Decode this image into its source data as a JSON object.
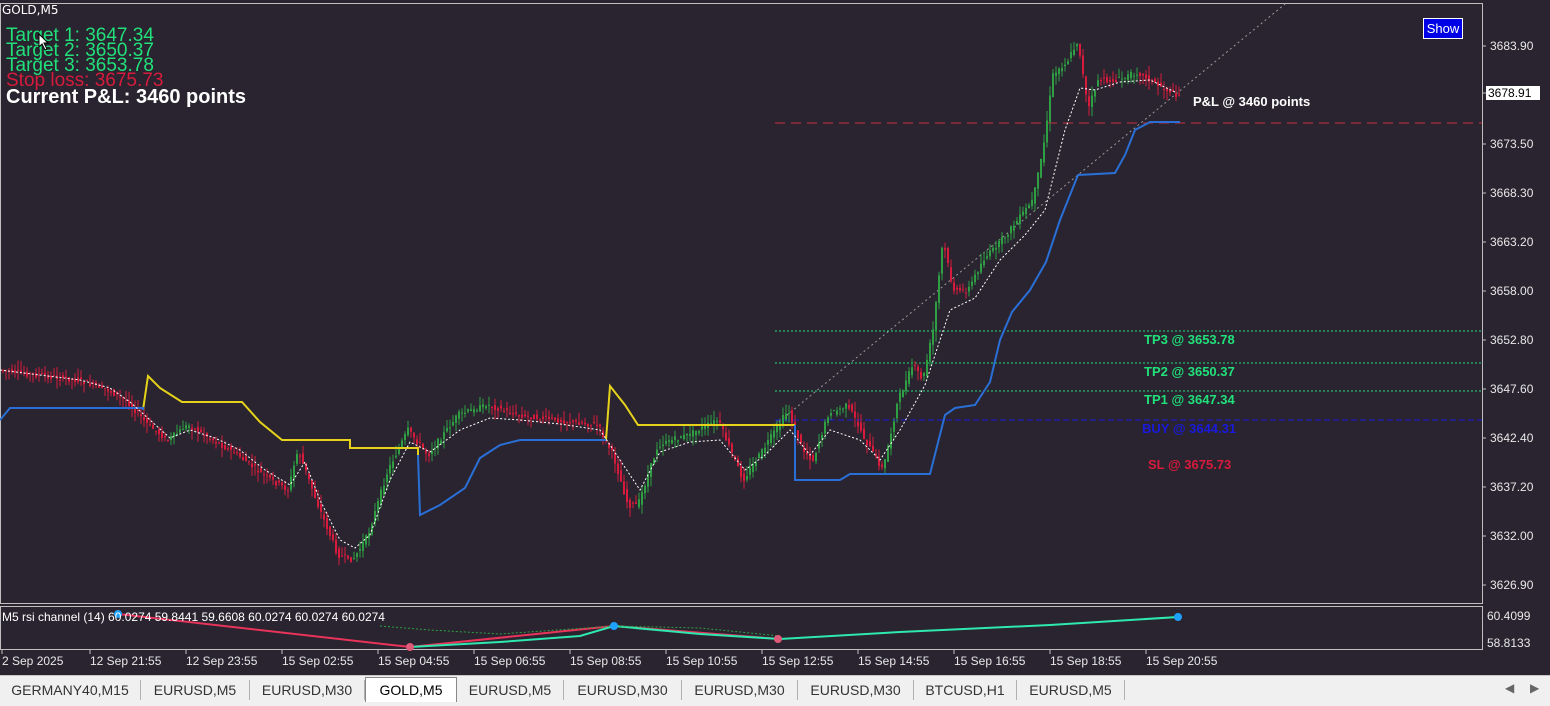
{
  "symbol": "GOLD,M5",
  "info": {
    "target1": "Target 1: 3647.34",
    "target2": "Target 2: 3650.37",
    "target3": "Target 3: 3653.78",
    "stop_loss": "Stop loss: 3675.73",
    "current_pnl": "Current P&L: 3460 points"
  },
  "show_button": "Show",
  "chart_labels": {
    "pnl": "P&L @ 3460 points",
    "tp3": "TP3 @ 3653.78",
    "tp2": "TP2 @ 3650.37",
    "tp1": "TP1 @ 3647.34",
    "buy": "BUY @ 3644.31",
    "sl": "SL @ 3675.73"
  },
  "price_axis": [
    "3683.90",
    "3678.91",
    "3673.50",
    "3668.30",
    "3663.20",
    "3658.00",
    "3652.80",
    "3647.60",
    "3642.40",
    "3637.20",
    "3632.00",
    "3626.90"
  ],
  "current_price": "3678.91",
  "rsi": {
    "label": "M5 rsi channel (14) 60.0274 59.8441 59.6608 60.0274 60.0274 60.0274",
    "axis_top": "60.4099",
    "axis_bottom": "58.8133"
  },
  "time_axis": [
    "2 Sep 2025",
    "12 Sep 21:55",
    "12 Sep 23:55",
    "15 Sep 02:55",
    "15 Sep 04:55",
    "15 Sep 06:55",
    "15 Sep 08:55",
    "15 Sep 10:55",
    "15 Sep 12:55",
    "15 Sep 14:55",
    "15 Sep 16:55",
    "15 Sep 18:55",
    "15 Sep 20:55"
  ],
  "tabs": [
    "GERMANY40,M15",
    "EURUSD,M5",
    "EURUSD,M30",
    "GOLD,M5",
    "EURUSD,M5",
    "EURUSD,M30",
    "EURUSD,M30",
    "EURUSD,M30",
    "BTCUSD,H1",
    "EURUSD,M5"
  ],
  "active_tab": 3,
  "colors": {
    "background": "#29242f",
    "bull": "#2ea043",
    "bear": "#d81b3c",
    "target": "#21e07a",
    "stop": "#d81b3c",
    "buy": "#1a1adc",
    "trail_blue": "#2a6fd6",
    "trail_yellow": "#e6d21a"
  },
  "chart_data": {
    "type": "line",
    "series": [
      {
        "name": "M5 rsi channel (14)",
        "values": [
          60.0274,
          59.8441,
          59.6608,
          60.0274,
          60.0274,
          60.0274
        ]
      }
    ]
  }
}
